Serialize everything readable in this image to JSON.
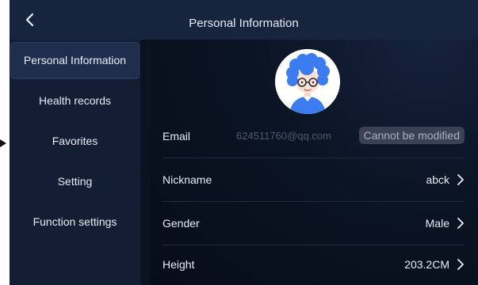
{
  "header": {
    "title": "Personal Information"
  },
  "sidebar": {
    "items": [
      {
        "label": "Personal Information"
      },
      {
        "label": "Health records"
      },
      {
        "label": "Favorites"
      },
      {
        "label": "Setting"
      },
      {
        "label": "Function settings"
      }
    ],
    "selected_index": 0
  },
  "profile": {
    "email": {
      "label": "Email",
      "value": "624511760@qq.com",
      "badge": "Cannot be modified"
    },
    "nickname": {
      "label": "Nickname",
      "value": "abck"
    },
    "gender": {
      "label": "Gender",
      "value": "Male"
    },
    "height": {
      "label": "Height",
      "value": "203.2CM"
    }
  },
  "icons": {
    "back": "chevron-left-icon",
    "row_arrow": "chevron-right-icon",
    "avatar": "cartoon-avatar-blue-curly-hair"
  },
  "colors": {
    "background": "#0a1322",
    "titlebar": "#17243e",
    "sidebar": "#131d33",
    "selected_item": "#1f2e4c",
    "badge_bg": "#3a4156",
    "avatar_hair": "#3d7cf0"
  }
}
